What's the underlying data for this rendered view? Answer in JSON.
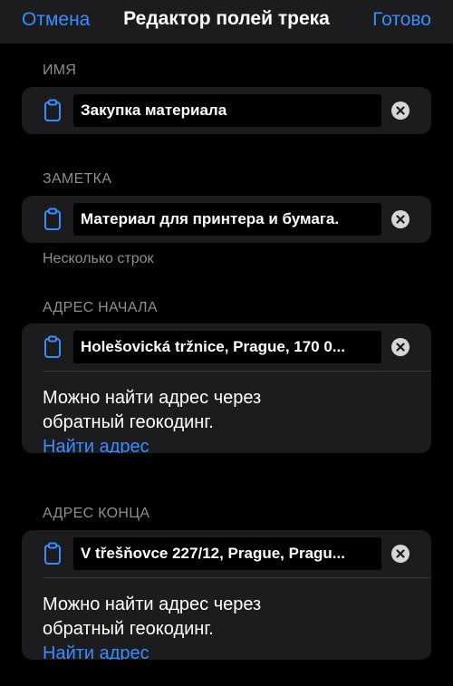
{
  "nav": {
    "cancel": "Отмена",
    "title": "Редактор полей трека",
    "done": "Готово"
  },
  "sections": {
    "name": {
      "header": "ИМЯ",
      "value": "Закупка материала"
    },
    "note": {
      "header": "ЗАМЕТКА",
      "value": "Материал для принтера и бумага.",
      "footer": "Несколько строк"
    },
    "start_address": {
      "header": "АДРЕС НАЧАЛА",
      "value": "Holešovická tržnice, Prague, 170 0...",
      "helper": "Можно найти адрес через обратный геокодинг.",
      "link": "Найти адрес"
    },
    "end_address": {
      "header": "АДРЕС КОНЦА",
      "value": "V třešňovce 227/12, Prague, Pragu...",
      "helper": "Можно найти адрес через обратный геокодинг.",
      "link": "Найти адрес"
    }
  },
  "icons": {
    "paste": "clipboard-icon",
    "clear": "clear-icon"
  },
  "colors": {
    "accent": "#3a8dff",
    "background": "#000000",
    "card": "#1c1c1e",
    "secondary_text": "#8e8e93"
  }
}
